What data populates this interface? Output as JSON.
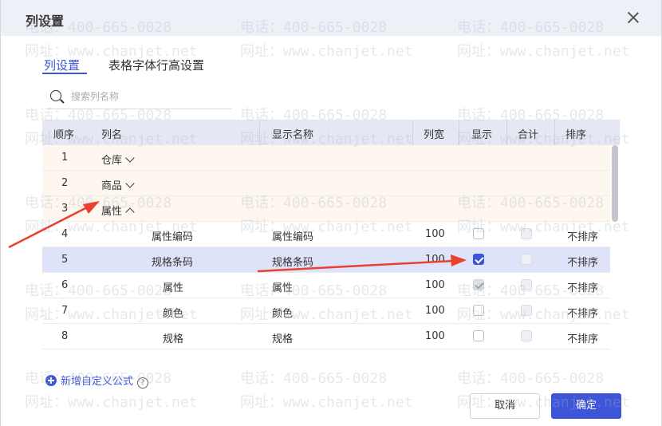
{
  "dialog": {
    "title": "列设置"
  },
  "tabs": [
    {
      "label": "列设置",
      "active": true
    },
    {
      "label": "表格字体行高设置",
      "active": false
    }
  ],
  "search": {
    "placeholder": "搜索列名称",
    "value": ""
  },
  "table": {
    "headers": {
      "order": "顺序",
      "col_name": "列名",
      "display_name": "显示名称",
      "width": "列宽",
      "show": "显示",
      "total": "合计",
      "sort": "排序"
    },
    "rows": [
      {
        "order": "1",
        "col_name": "仓库",
        "expander": "collapsed"
      },
      {
        "order": "2",
        "col_name": "商品",
        "expander": "collapsed"
      },
      {
        "order": "3",
        "col_name": "属性",
        "expander": "expanded"
      },
      {
        "order": "4",
        "col_name": "属性编码",
        "display_name": "属性编码",
        "width": "100",
        "show": "unchecked",
        "total": "disabled",
        "sort": "不排序"
      },
      {
        "order": "5",
        "col_name": "规格条码",
        "display_name": "规格条码",
        "width": "100",
        "show": "checked",
        "total": "disabled",
        "sort": "不排序",
        "selected": true
      },
      {
        "order": "6",
        "col_name": "属性",
        "display_name": "属性",
        "width": "100",
        "show": "checked-disabled",
        "total": "disabled",
        "sort": "不排序"
      },
      {
        "order": "7",
        "col_name": "颜色",
        "display_name": "颜色",
        "width": "100",
        "show": "unchecked",
        "total": "disabled",
        "sort": "不排序"
      },
      {
        "order": "8",
        "col_name": "规格",
        "display_name": "规格",
        "width": "100",
        "show": "unchecked",
        "total": "disabled",
        "sort": "不排序"
      }
    ]
  },
  "footer": {
    "add_custom_formula": "新增自定义公式",
    "help_glyph": "?",
    "cancel_label": "取消",
    "ok_label": "确定"
  },
  "watermark": {
    "phone": "电话：400-665-0028",
    "site": "网址：www.chanjet.net"
  },
  "colors": {
    "accent": "#3d55d9",
    "group_row_bg": "#fdf7f0",
    "selected_row_bg": "#dfe3f9",
    "header_bg": "#e5e8f3",
    "annotation_arrow": "#e8412f"
  },
  "icons": {
    "close": "close-icon",
    "search": "search-icon",
    "expand": "chevron-down-icon",
    "collapse": "chevron-up-icon",
    "add": "plus-circle-icon",
    "help": "help-icon"
  }
}
